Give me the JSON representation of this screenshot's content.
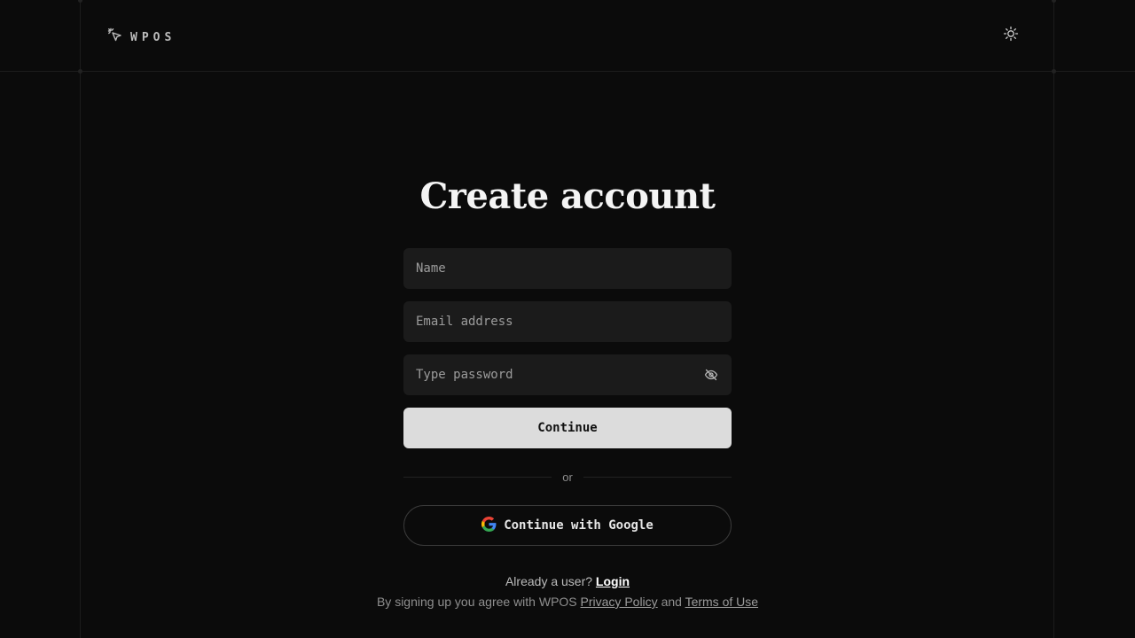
{
  "header": {
    "logo_text": "WPOS",
    "logo_icon": "cursor-sparkle-icon",
    "theme_icon": "sun-icon"
  },
  "main": {
    "title": "Create account",
    "fields": {
      "name_placeholder": "Name",
      "email_placeholder": "Email address",
      "password_placeholder": "Type password",
      "password_toggle_icon": "eye-off-icon"
    },
    "continue_label": "Continue",
    "divider_text": "or",
    "google_label": "Continue with Google",
    "google_icon": "google-icon"
  },
  "footer": {
    "already_text": "Already a user?",
    "login_label": "Login",
    "agree_text": "By signing up you agree with WPOS",
    "privacy_label": "Privacy Policy",
    "and_text": "and",
    "terms_label": "Terms of Use"
  },
  "colors": {
    "background": "#0b0b0b",
    "field_bg": "#1b1b1b",
    "primary_button": "#dcdcdc"
  }
}
